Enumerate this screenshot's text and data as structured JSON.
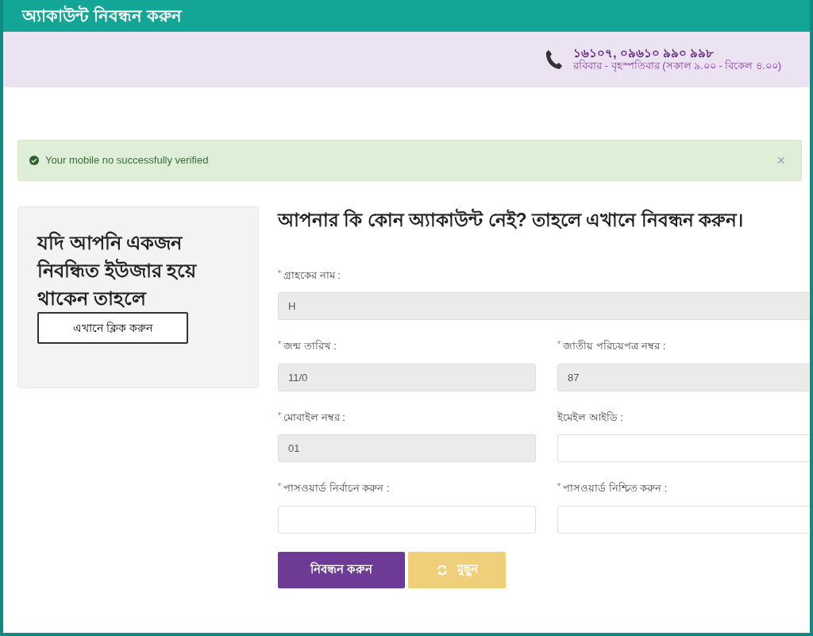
{
  "window": {
    "title": "অ্যাকাউন্ট নিবন্ধন করুন"
  },
  "header": {
    "hotline": "১৬১০৭, ০৯৬১০ ৯৯০ ৯৯৮",
    "hours": "রবিবার - বৃহস্পতিবার (সকাল ৯.০০ - বিকেল ৪.০০)"
  },
  "alert": {
    "message": "Your mobile no successfully verified",
    "close": "×"
  },
  "login_card": {
    "heading": "যদি আপনি একজন নিবন্ধিত ইউজার হয়ে থাকেন তাহলে",
    "button": "এখানে ক্লিক করুন"
  },
  "form": {
    "heading": "আপনার কি কোন অ্যাকাউন্ট নেই? তাহলে এখানে নিবন্ধন করুন।",
    "full_fields": [
      {
        "marker": "*",
        "label": "গ্রাহকের নাম :",
        "disabled": true,
        "value": "H"
      }
    ],
    "fields": [
      {
        "marker": "*",
        "label": "জন্ম তারিখ :",
        "disabled": true,
        "value": "11/0"
      },
      {
        "marker": "*",
        "label": "জাতীয় পরিচয়পত্র নম্বর :",
        "disabled": true,
        "value": "87"
      },
      {
        "marker": "*",
        "label": "মোবাইল নম্বর :",
        "disabled": true,
        "value": "01"
      },
      {
        "label": "ইমেইল আইডি :",
        "disabled": false
      },
      {
        "marker": "*",
        "label": "পাসওয়ার্ড নির্বাচন করুন :",
        "disabled": false
      },
      {
        "marker": "*",
        "label": "পাসওয়ার্ড নিশ্চিত করুন :",
        "disabled": false
      }
    ],
    "buttons": [
      {
        "kind": "submit",
        "label": "নিবন্ধন করুন"
      },
      {
        "kind": "reset",
        "label": "মুছুন"
      }
    ]
  }
}
